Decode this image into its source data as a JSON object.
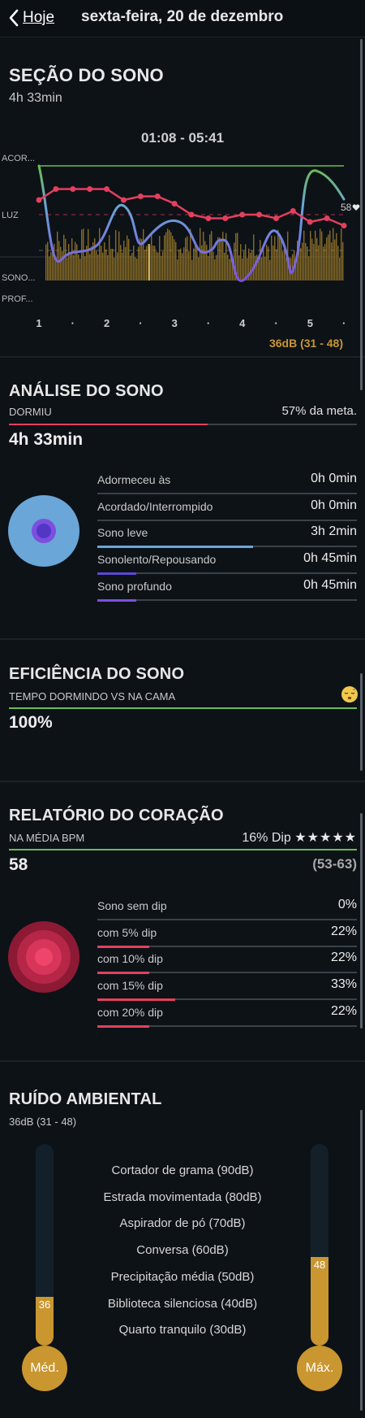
{
  "nav": {
    "back_label": "Hoje",
    "title": "sexta-feira, 20 de dezembro"
  },
  "session": {
    "title": "SEÇÃO DO SONO",
    "duration": "4h 33min",
    "time_range": "01:08 - 05:41",
    "y_labels": [
      "ACOR...",
      "LUZ",
      "SONO...",
      "PROF..."
    ],
    "x_labels": [
      "1",
      "·",
      "2",
      "·",
      "3",
      "·",
      "4",
      "·",
      "5",
      "·"
    ],
    "hr_label": "58",
    "heart_icon": "heart-icon",
    "noise_label": "36dB (31 - 48)",
    "colors": {
      "sleep_line": "#6aa6d8",
      "deep_line": "#7c4fe0",
      "hr_line": "#e2405e",
      "noise": "#b08a2c",
      "awake_line": "#6cbc4e"
    }
  },
  "chart_data": {
    "type": "line",
    "title": "",
    "xlabel": "",
    "ylabel": "",
    "x": [
      "1",
      "·",
      "2",
      "·",
      "3",
      "·",
      "4",
      "·",
      "5",
      "·"
    ],
    "series": [
      {
        "values": [
          68,
          71,
          71,
          71,
          71,
          68,
          69,
          69,
          67,
          64,
          63,
          63,
          64,
          64,
          63,
          65,
          62,
          63,
          61
        ]
      }
    ]
  },
  "analysis": {
    "title": "ANÁLISE DO SONO",
    "subtitle": "DORMIU",
    "goal": "57% da meta.",
    "goal_fraction": 0.57,
    "total": "4h 33min",
    "rows": [
      {
        "label": "Adormeceu às",
        "value": "0h 0min",
        "fraction": 0,
        "color": "#3a4249"
      },
      {
        "label": "Acordado/Interrompido",
        "value": "0h 0min",
        "fraction": 0,
        "color": "#3a4249"
      },
      {
        "label": "Sono leve",
        "value": "3h 2min",
        "fraction": 0.6,
        "color": "#6aa6d8"
      },
      {
        "label": "Sonolento/Repousando",
        "value": "0h 45min",
        "fraction": 0.15,
        "color": "#5b48d6"
      },
      {
        "label": "Sono profundo",
        "value": "0h 45min",
        "fraction": 0.15,
        "color": "#7c4fe0"
      }
    ]
  },
  "efficiency": {
    "title": "EFICIÊNCIA DO SONO",
    "subtitle": "TEMPO DORMINDO VS NA CAMA",
    "icon": "sleepy-face-icon",
    "value": "100%",
    "fraction": 1.0
  },
  "heart": {
    "title": "RELATÓRIO DO CORAÇÃO",
    "subtitle": "NA MÉDIA BPM",
    "dip_text": "16% Dip",
    "stars": "★★★★★",
    "bpm": "58",
    "range": "(53-63)",
    "rows": [
      {
        "label": "Sono sem dip",
        "value": "0%",
        "fraction": 0
      },
      {
        "label": "com 5% dip",
        "value": "22%",
        "fraction": 0.2
      },
      {
        "label": "com 10% dip",
        "value": "22%",
        "fraction": 0.2
      },
      {
        "label": "com 15% dip",
        "value": "33%",
        "fraction": 0.3
      },
      {
        "label": "com 20% dip",
        "value": "22%",
        "fraction": 0.2
      }
    ]
  },
  "noise": {
    "title": "RUÍDO AMBIENTAL",
    "subtitle": "36dB (31 - 48)",
    "items": [
      "Cortador de grama (90dB)",
      "Estrada movimentada (80dB)",
      "Aspirador de pó (70dB)",
      "Conversa (60dB)",
      "Precipitação média (50dB)",
      "Biblioteca silenciosa (40dB)",
      "Quarto tranquilo (30dB)"
    ],
    "avg_value": "36",
    "avg_fraction": 0.24,
    "avg_label": "Méd.",
    "max_value": "48",
    "max_fraction": 0.44,
    "max_label": "Máx."
  }
}
